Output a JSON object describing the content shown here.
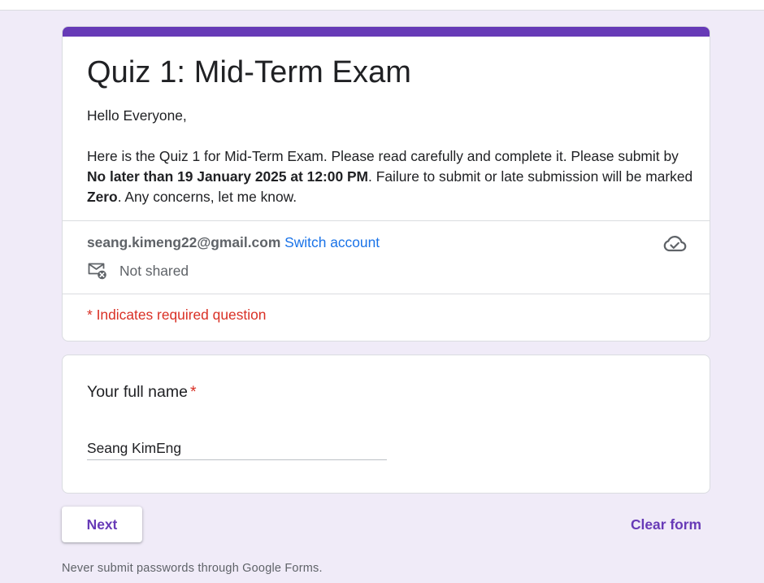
{
  "form": {
    "title": "Quiz 1: Mid-Term Exam",
    "description": {
      "greeting": "Hello Everyone,",
      "text_before_deadline": "Here is the Quiz 1 for Mid-Term Exam. Please read carefully and complete it. Please submit by ",
      "deadline": "No later than 19 January 2025 at 12:00 PM",
      "text_after_deadline": ". Failure to submit or late submission will be marked ",
      "penalty": "Zero",
      "text_end": ". Any concerns, let me know."
    },
    "account": {
      "email": "seang.kimeng22@gmail.com",
      "switch_label": "Switch account",
      "shared_status": "Not shared",
      "cloud_icon": "cloud-done-icon",
      "mail_icon": "mail-not-shared-icon"
    },
    "required_note": "* Indicates required question"
  },
  "question": {
    "label": "Your full name",
    "required_marker": "*",
    "value": "Seang KimEng"
  },
  "actions": {
    "next_label": "Next",
    "clear_label": "Clear form"
  },
  "footer": {
    "note": "Never submit passwords through Google Forms."
  },
  "colors": {
    "accent": "#673ab7",
    "background": "#f0ebf8",
    "link": "#1a73e8",
    "required": "#d93025"
  }
}
